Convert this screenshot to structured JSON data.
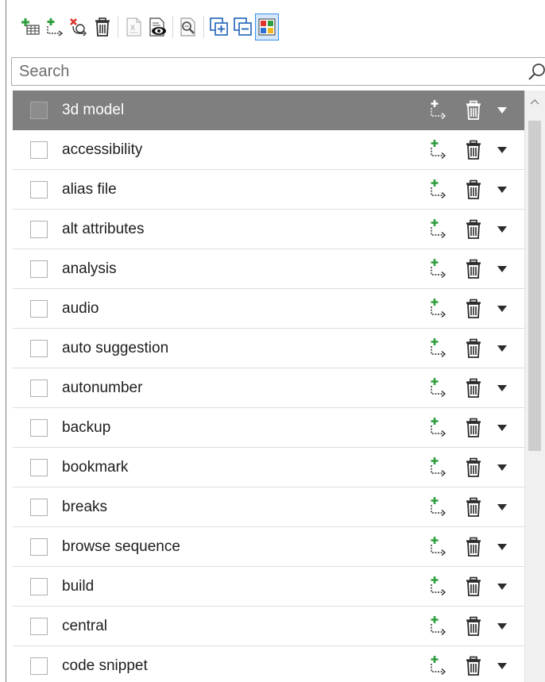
{
  "search": {
    "placeholder": "Search"
  },
  "toolbar": {
    "buttons": [
      {
        "icon": "add-category-icon"
      },
      {
        "icon": "add-tag-icon"
      },
      {
        "icon": "remove-tag-icon"
      },
      {
        "icon": "delete-icon"
      },
      {
        "icon": "export-excel-icon"
      },
      {
        "icon": "preview-icon"
      },
      {
        "icon": "properties-icon"
      },
      {
        "icon": "expand-all-icon"
      },
      {
        "icon": "collapse-all-icon"
      },
      {
        "icon": "color-view-icon",
        "active": true
      }
    ]
  },
  "list": {
    "selected_index": 0,
    "items": [
      {
        "label": "3d model"
      },
      {
        "label": "accessibility"
      },
      {
        "label": "alias file"
      },
      {
        "label": "alt attributes"
      },
      {
        "label": "analysis"
      },
      {
        "label": "audio"
      },
      {
        "label": "auto suggestion"
      },
      {
        "label": "autonumber"
      },
      {
        "label": "backup"
      },
      {
        "label": "bookmark"
      },
      {
        "label": "breaks"
      },
      {
        "label": "browse sequence"
      },
      {
        "label": "build"
      },
      {
        "label": "central"
      },
      {
        "label": "code snippet"
      }
    ]
  },
  "colors": {
    "selected_row": "#7f7f7f",
    "active_tool_border": "#3c8ee6",
    "active_tool_fill": "#d4e7fb",
    "add_green": "#2e9e3e",
    "remove_red": "#d9342b"
  }
}
